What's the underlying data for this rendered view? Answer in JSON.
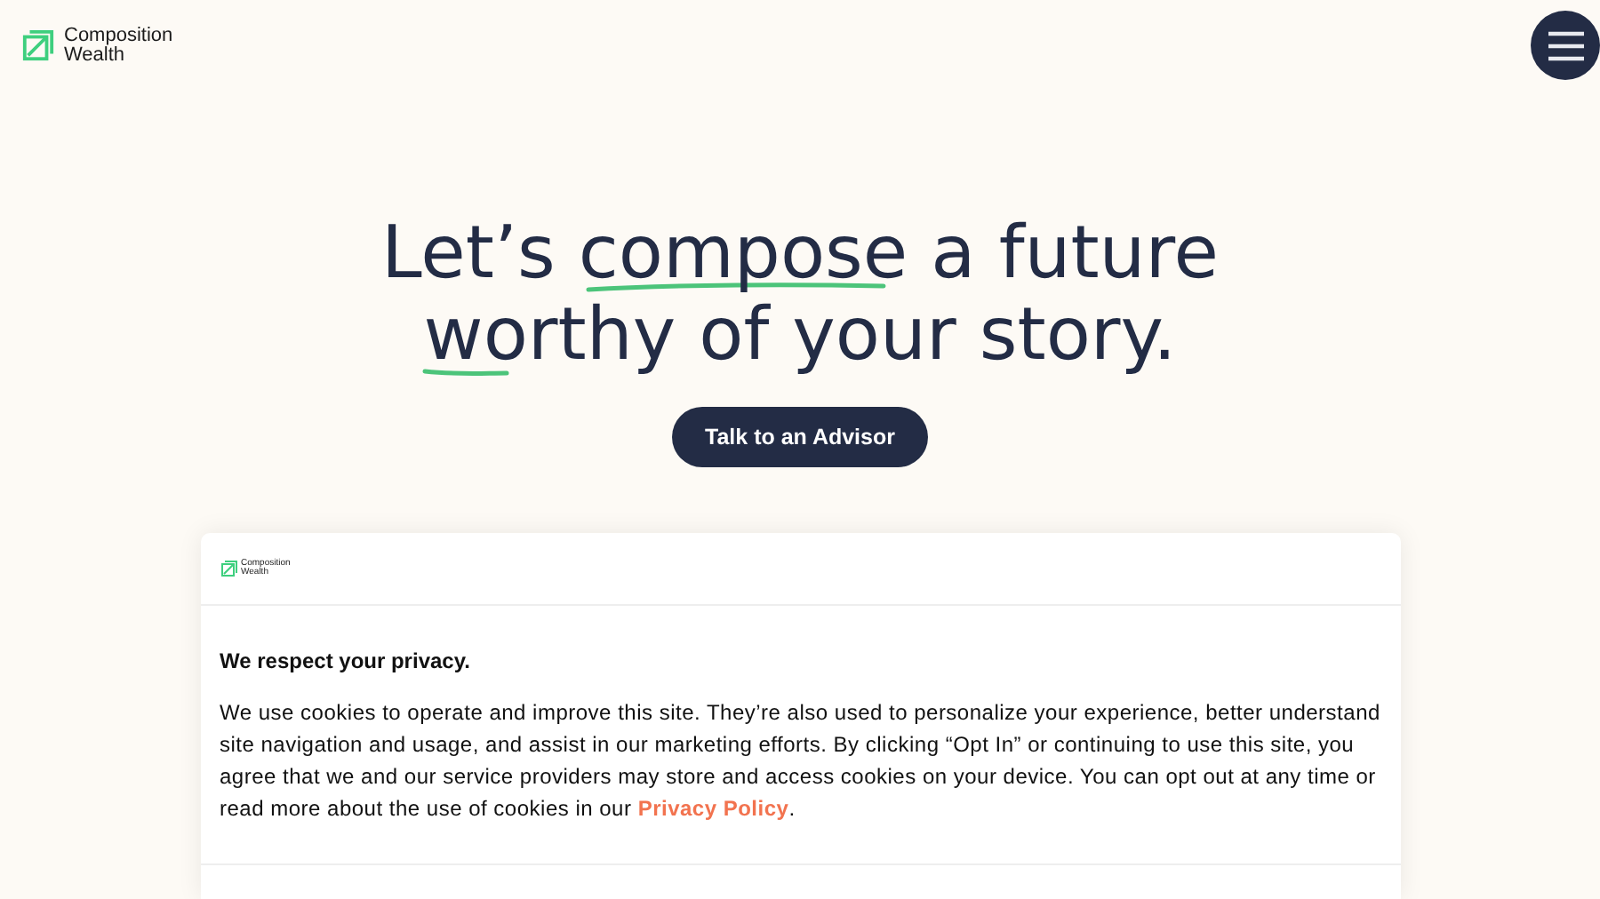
{
  "header": {
    "logo_lines": [
      "Composition",
      "Wealth"
    ]
  },
  "hero": {
    "headline_lines": [
      "Let’s compose a future",
      "worthy of your story."
    ],
    "cta": "Talk to an Advisor"
  },
  "cookie_dialog": {
    "logo_lines": [
      "Composition",
      "Wealth"
    ],
    "title": "We respect your privacy.",
    "body": "We use cookies to operate and improve this site. They’re also used to personalize your experience, better understand site navigation and usage, and assist in our marketing efforts. By clicking “Opt In” or continuing to use this site, you agree that we and our service providers may store and access cookies on your device. You can opt out at any time or read more about the use of cookies in our ",
    "link": "Privacy Policy",
    "body_end": "."
  }
}
